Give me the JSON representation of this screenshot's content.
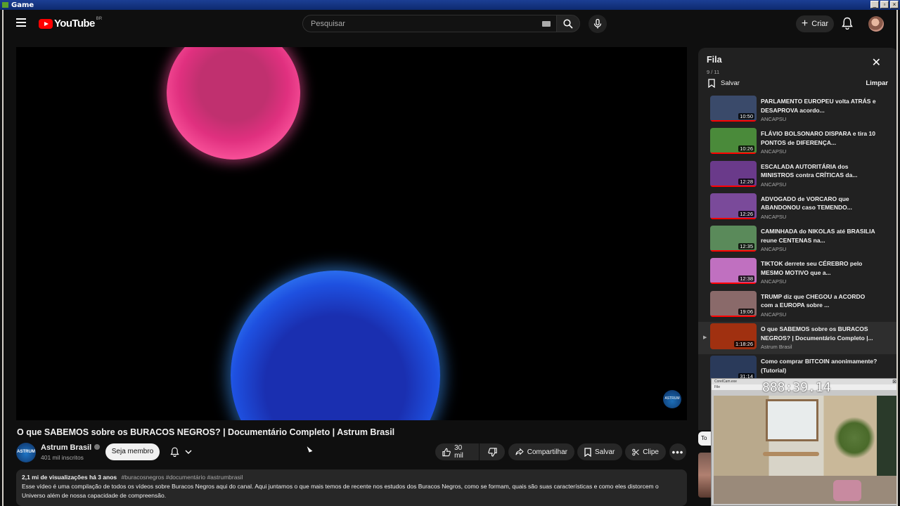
{
  "window": {
    "title": "Game"
  },
  "masthead": {
    "logo_text": "YouTube",
    "logo_country": "BR",
    "search_placeholder": "Pesquisar",
    "create_label": "Criar"
  },
  "video": {
    "title": "O que SABEMOS sobre os BURACOS NEGROS? | Documentário Completo | Astrum Brasil",
    "channel_name": "Astrum Brasil",
    "channel_avatar_text": "ASTRUM",
    "subscribers": "401 mil inscritos",
    "member_label": "Seja membro",
    "likes": "30 mil",
    "share_label": "Compartilhar",
    "save_label": "Salvar",
    "clip_label": "Clipe",
    "more_label": "•••",
    "watermark": "ASTRUM",
    "views": "2,1 mi de visualizações",
    "age": "há 3 anos",
    "hashtags": "#buracosnegros #documentário #astrumbrasil",
    "description": "Esse vídeo é uma compilação de todos os vídeos sobre Buracos Negros aqui do canal. Aqui juntamos o que mais temos de recente nos estudos dos Buracos Negros, como se formam, quais são suas características e como eles distorcem o Universo além de nossa capacidade de compreensão."
  },
  "queue": {
    "title": "Fila",
    "count": "9 / 11",
    "save_label": "Salvar",
    "clear_label": "Limpar",
    "items": [
      {
        "title": "PARLAMENTO EUROPEU volta ATRÁS e DESAPROVA acordo...",
        "channel": "ANCAPSU",
        "duration": "10:50",
        "thumb": "#3a4a6a",
        "progress": 1.0
      },
      {
        "title": "FLÁVIO BOLSONARO DISPARA e tira 10 PONTOS de DIFERENÇA...",
        "channel": "ANCAPSU",
        "duration": "10:26",
        "thumb": "#4a8a3a",
        "progress": 1.0
      },
      {
        "title": "ESCALADA AUTORITÁRIA dos MINISTROS contra CRÍTICAS da...",
        "channel": "ANCAPSU",
        "duration": "12:28",
        "thumb": "#6a3a8a",
        "progress": 1.0
      },
      {
        "title": "ADVOGADO de VORCARO que ABANDONOU caso TEMENDO...",
        "channel": "ANCAPSU",
        "duration": "12:26",
        "thumb": "#7a4a9a",
        "progress": 1.0
      },
      {
        "title": "CAMINHADA do NIKOLAS até BRASILIA reune CENTENAS na...",
        "channel": "ANCAPSU",
        "duration": "12:35",
        "thumb": "#5a8a5a",
        "progress": 1.0
      },
      {
        "title": "TIKTOK derrete seu CÉREBRO pelo MESMO MOTIVO que a...",
        "channel": "ANCAPSU",
        "duration": "12:38",
        "thumb": "#c070c0",
        "progress": 1.0
      },
      {
        "title": "TRUMP diz que CHEGOU a ACORDO com a EUROPA sobre ...",
        "channel": "ANCAPSU",
        "duration": "19:06",
        "thumb": "#8a6a6a",
        "progress": 1.0
      },
      {
        "title": "O que SABEMOS sobre os BURACOS NEGROS? | Documentário Completo |...",
        "channel": "Astrum Brasil",
        "duration": "1:18:26",
        "thumb": "#a03010",
        "progress": 0.0,
        "active": true
      },
      {
        "title": "Como comprar BITCOIN anonimamente? (Tutorial)",
        "channel": "",
        "duration": "31:14",
        "thumb": "#2a3a5a",
        "progress": 0.0
      }
    ]
  },
  "webcam": {
    "title": "CorelCam.exe",
    "menu": "File",
    "timer": "888:39.14"
  },
  "side_button": "To"
}
